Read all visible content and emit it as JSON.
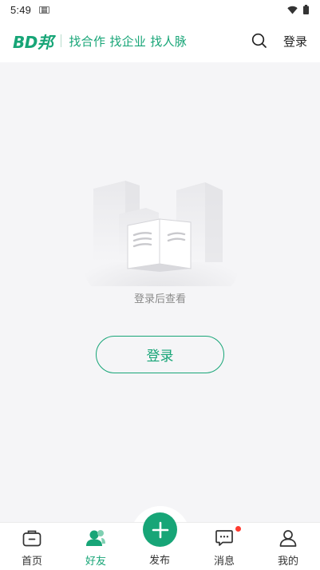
{
  "status_bar": {
    "time": "5:49"
  },
  "header": {
    "logo": "BD邦",
    "slogan": "找合作 找企业 找人脉",
    "login_label": "登录",
    "accent_color": "#17a577"
  },
  "empty_state": {
    "message": "登录后查看",
    "login_button": "登录"
  },
  "bottom_nav": {
    "items": [
      {
        "label": "首页",
        "icon": "home-box-icon",
        "active": false
      },
      {
        "label": "好友",
        "icon": "friends-icon",
        "active": true
      },
      {
        "label": "发布",
        "icon": "plus-icon",
        "active": false
      },
      {
        "label": "消息",
        "icon": "message-icon",
        "active": false,
        "badge": true
      },
      {
        "label": "我的",
        "icon": "profile-icon",
        "active": false
      }
    ]
  }
}
